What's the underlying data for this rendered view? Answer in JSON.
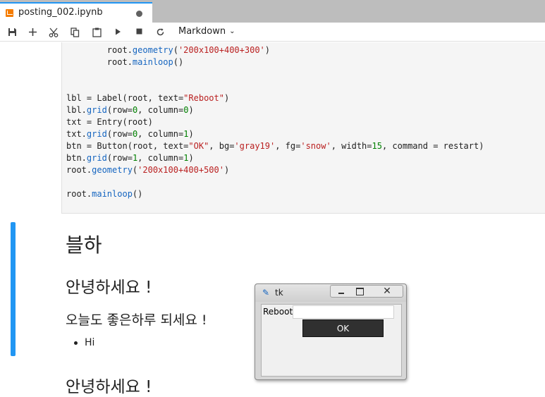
{
  "tab": {
    "title": "posting_002.ipynb"
  },
  "toolbar": {
    "cell_type": "Markdown"
  },
  "code_cell": {
    "lines": [
      [
        {
          "t": "        root."
        },
        {
          "t": "geometry",
          "c": "fn"
        },
        {
          "t": "("
        },
        {
          "t": "'200x100+400+300'",
          "c": "str"
        },
        {
          "t": ")"
        }
      ],
      [
        {
          "t": "        root."
        },
        {
          "t": "mainloop",
          "c": "fn"
        },
        {
          "t": "()"
        }
      ],
      [],
      [],
      [
        {
          "t": "lbl = Label(root, text="
        },
        {
          "t": "\"Reboot\"",
          "c": "str"
        },
        {
          "t": ")"
        }
      ],
      [
        {
          "t": "lbl."
        },
        {
          "t": "grid",
          "c": "fn"
        },
        {
          "t": "(row="
        },
        {
          "t": "0",
          "c": "num"
        },
        {
          "t": ", column="
        },
        {
          "t": "0",
          "c": "num"
        },
        {
          "t": ")"
        }
      ],
      [
        {
          "t": "txt = Entry(root)"
        }
      ],
      [
        {
          "t": "txt."
        },
        {
          "t": "grid",
          "c": "fn"
        },
        {
          "t": "(row="
        },
        {
          "t": "0",
          "c": "num"
        },
        {
          "t": ", column="
        },
        {
          "t": "1",
          "c": "num"
        },
        {
          "t": ")"
        }
      ],
      [
        {
          "t": "btn = Button(root, text="
        },
        {
          "t": "\"OK\"",
          "c": "str"
        },
        {
          "t": ", bg="
        },
        {
          "t": "'gray19'",
          "c": "str"
        },
        {
          "t": ", fg="
        },
        {
          "t": "'snow'",
          "c": "str"
        },
        {
          "t": ", width="
        },
        {
          "t": "15",
          "c": "num"
        },
        {
          "t": ", command = restart)"
        }
      ],
      [
        {
          "t": "btn."
        },
        {
          "t": "grid",
          "c": "fn"
        },
        {
          "t": "(row="
        },
        {
          "t": "1",
          "c": "num"
        },
        {
          "t": ", column="
        },
        {
          "t": "1",
          "c": "num"
        },
        {
          "t": ")"
        }
      ],
      [
        {
          "t": "root."
        },
        {
          "t": "geometry",
          "c": "fn"
        },
        {
          "t": "("
        },
        {
          "t": "'200x100+400+500'",
          "c": "str"
        },
        {
          "t": ")"
        }
      ],
      [],
      [
        {
          "t": "root."
        },
        {
          "t": "mainloop",
          "c": "fn"
        },
        {
          "t": "()"
        }
      ]
    ]
  },
  "markdown": {
    "h1": "블하",
    "h2": "안녕하세요 !",
    "h3": "오늘도 좋은하루 되세요 !",
    "list_item": "Hi",
    "h2_second": "안녕하세요 !"
  },
  "tk_window": {
    "title": "tk",
    "label": "Reboot",
    "entry_value": "",
    "button": "OK"
  },
  "colors": {
    "accent": "#2196f3",
    "string": "#ba2121",
    "number": "#008000",
    "function": "#1565c0",
    "tk_button_bg": "#303030"
  },
  "icons": {
    "tab": "notebook-icon",
    "toolbar": [
      "save-icon",
      "add-cell-icon",
      "cut-icon",
      "copy-icon",
      "paste-icon",
      "run-icon",
      "stop-icon",
      "restart-icon",
      "chevron-down-icon"
    ],
    "tk": "feather-icon"
  }
}
